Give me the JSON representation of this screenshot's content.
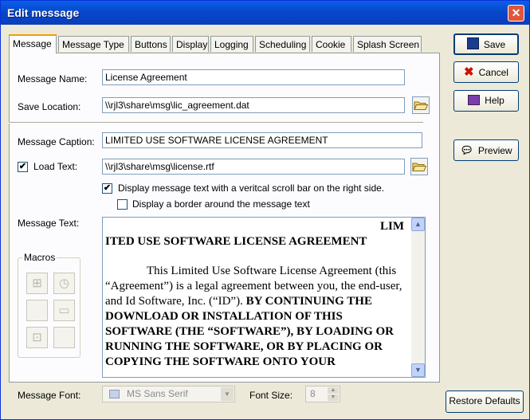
{
  "window": {
    "title": "Edit message",
    "close_label": "✕"
  },
  "tabs": [
    "Message",
    "Message Type",
    "Buttons",
    "Display",
    "Logging",
    "Scheduling",
    "Cookie",
    "Splash Screen"
  ],
  "fields": {
    "message_name": {
      "label": "Message Name:",
      "value": "License Agreement"
    },
    "save_location": {
      "label": "Save Location:",
      "value": "\\\\rjl3\\share\\msg\\lic_agreement.dat"
    },
    "message_caption": {
      "label": "Message Caption:",
      "value": "LIMITED USE SOFTWARE LICENSE AGREEMENT"
    },
    "load_text": {
      "label": "Load Text:",
      "checked": true,
      "value": "\\\\rjl3\\share\\msg\\license.rtf"
    },
    "scroll_option": {
      "label": "Display message text with a veritcal scroll bar on the right side.",
      "checked": true
    },
    "border_option": {
      "label": "Display a border around the message text",
      "checked": false
    },
    "message_text": {
      "label": "Message Text:",
      "line1": "LIM",
      "line2": "ITED USE SOFTWARE LICENSE AGREEMENT",
      "para_plain": "This Limited Use Software License Agreement (this “Agreement”) is a legal agreement between you, the end-user, and Id Software, Inc. (“ID”).",
      "para_bold": "BY CONTINUING THE DOWNLOAD OR INSTALLATION OF THIS SOFTWARE (THE “SOFTWARE”), BY LOADING OR RUNNING THE SOFTWARE, OR BY PLACING OR COPYING THE SOFTWARE ONTO YOUR"
    },
    "macros": {
      "label": "Macros"
    },
    "message_font": {
      "label": "Message Font:",
      "value": "MS Sans Serif"
    },
    "font_size": {
      "label": "Font Size:",
      "value": "8"
    }
  },
  "buttons": {
    "save": "Save",
    "cancel": "Cancel",
    "help": "Help",
    "preview": "Preview",
    "restore_defaults": "Restore Defaults"
  },
  "colors": {
    "titlebar": "#0a5fe8",
    "dialog": "#ece9d8",
    "tab_accent": "#f0a000",
    "cancel_icon": "#cc1100"
  }
}
